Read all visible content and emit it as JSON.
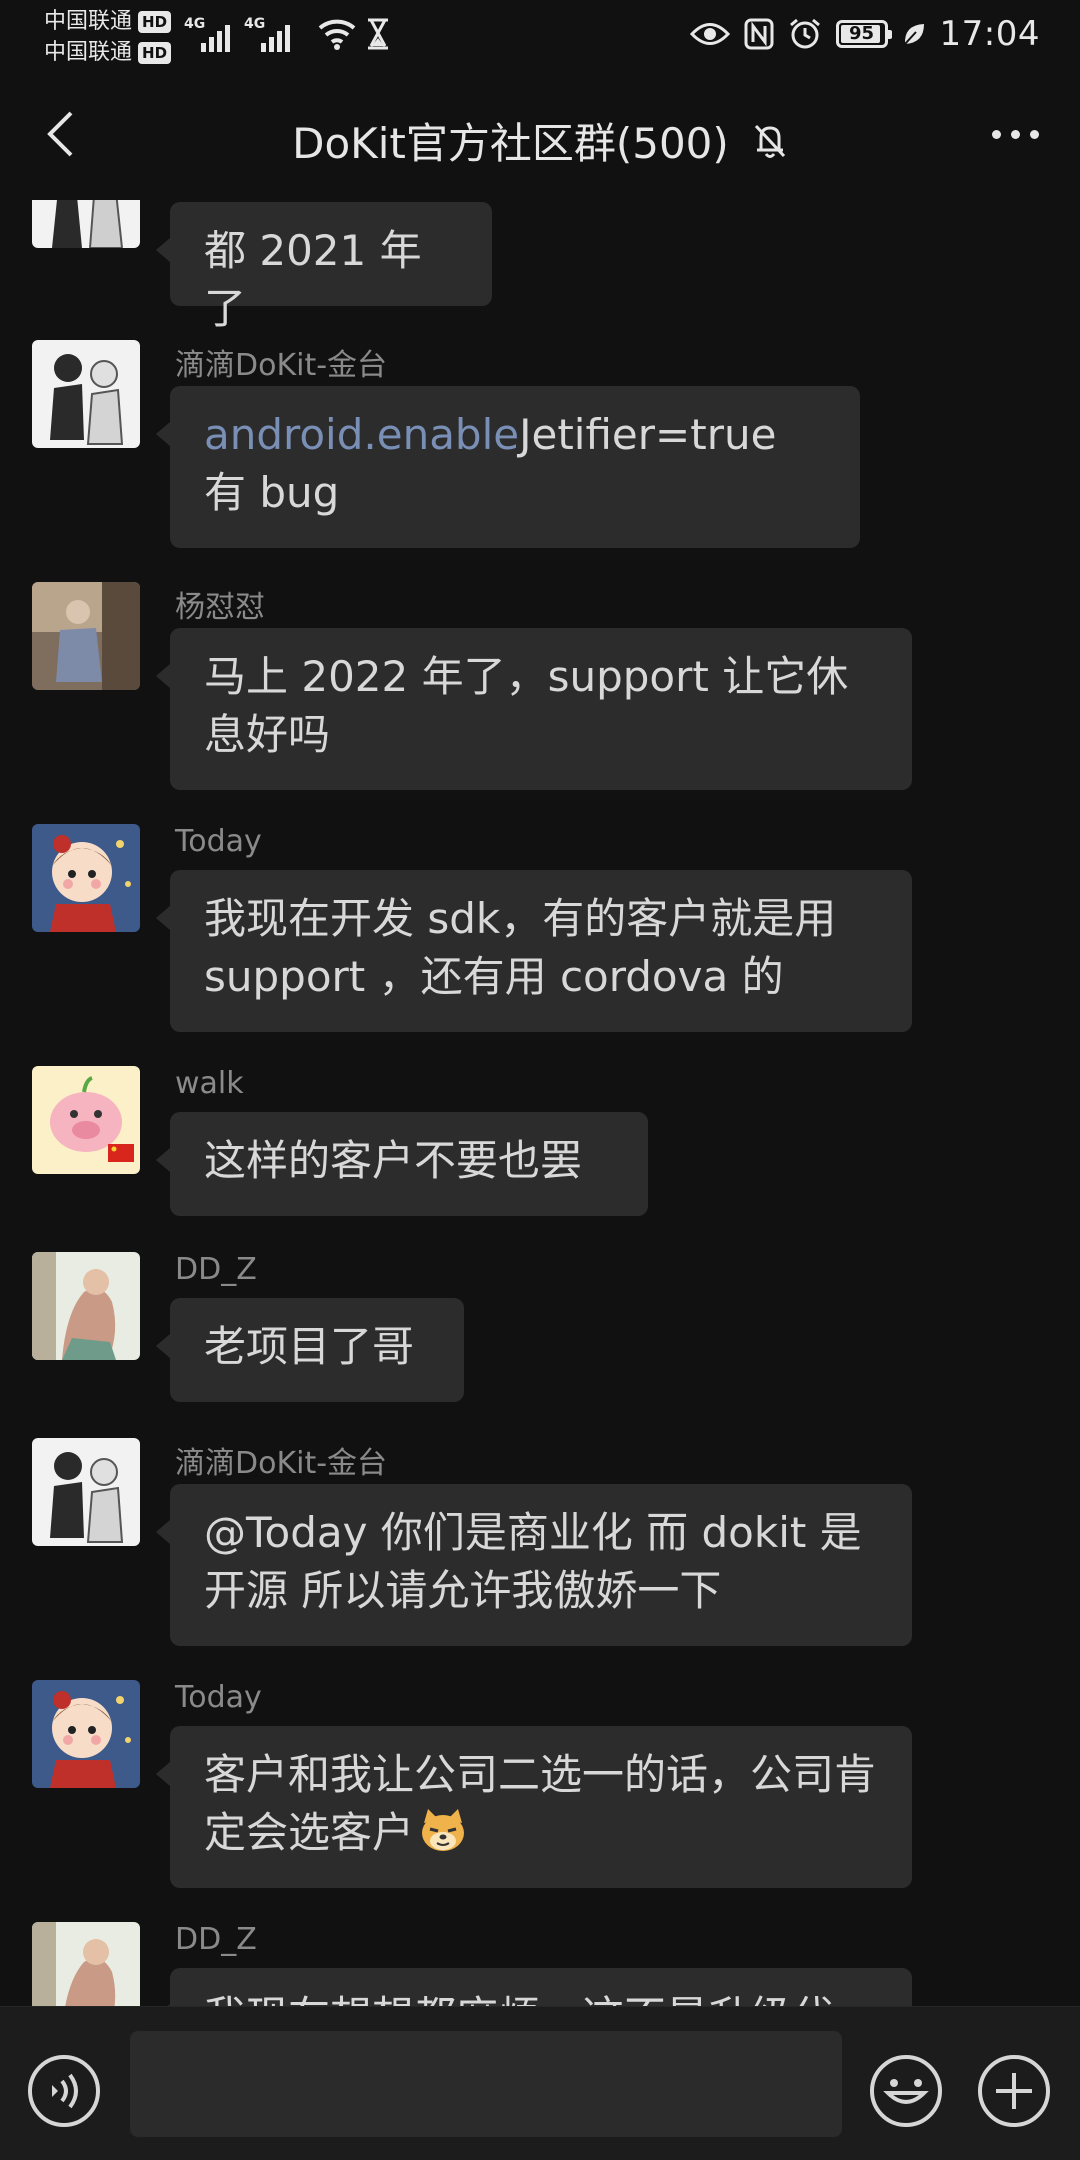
{
  "status_bar": {
    "carrier_1": "中国联通",
    "carrier_2": "中国联通",
    "hd_1": "HD",
    "hd_2": "HD",
    "net_1": "4G",
    "net_2": "4G",
    "battery": "95",
    "battery_level": 0.95,
    "time": "17:04"
  },
  "header": {
    "title": "DoKit官方社区群(500)",
    "back_icon": "chevron-left-icon",
    "mute_icon": "bell-off-icon",
    "more_icon": "more-horizontal-icon"
  },
  "messages": [
    {
      "sender": "",
      "text": "都 2021 年了",
      "avatar": "sketch-two-figures"
    },
    {
      "sender": "滴滴DoKit-金台",
      "link": "android.enable",
      "text": "Jetifier=true 有 bug",
      "avatar": "sketch-two-figures"
    },
    {
      "sender": "杨怼怼",
      "text": "马上 2022 年了，support 让它休息好吗",
      "avatar": "photo-person-sitting"
    },
    {
      "sender": "Today",
      "text": "我现在开发 sdk，有的客户就是用 support ，还有用 cordova 的",
      "avatar": "cartoon-child"
    },
    {
      "sender": "walk",
      "text": "这样的客户不要也罢",
      "avatar": "cartoon-pig-flag"
    },
    {
      "sender": "DD_Z",
      "text": "老项目了哥",
      "avatar": "painting-figure"
    },
    {
      "sender": "滴滴DoKit-金台",
      "text": "@Today  你们是商业化 而 dokit 是开源 所以请允许我傲娇一下",
      "avatar": "sketch-two-figures"
    },
    {
      "sender": "Today",
      "text": "客户和我让公司二选一的话，公司肯定会选客户",
      "emoji": "doge-emoji",
      "avatar": "cartoon-child"
    },
    {
      "sender": "DD_Z",
      "text": "我现在想想都麻烦，这不是升级代",
      "avatar": "painting-figure"
    }
  ],
  "input_bar": {
    "voice_icon": "voice-icon",
    "input_value": "",
    "emoji_icon": "smile-icon",
    "plus_icon": "plus-circle-icon"
  }
}
